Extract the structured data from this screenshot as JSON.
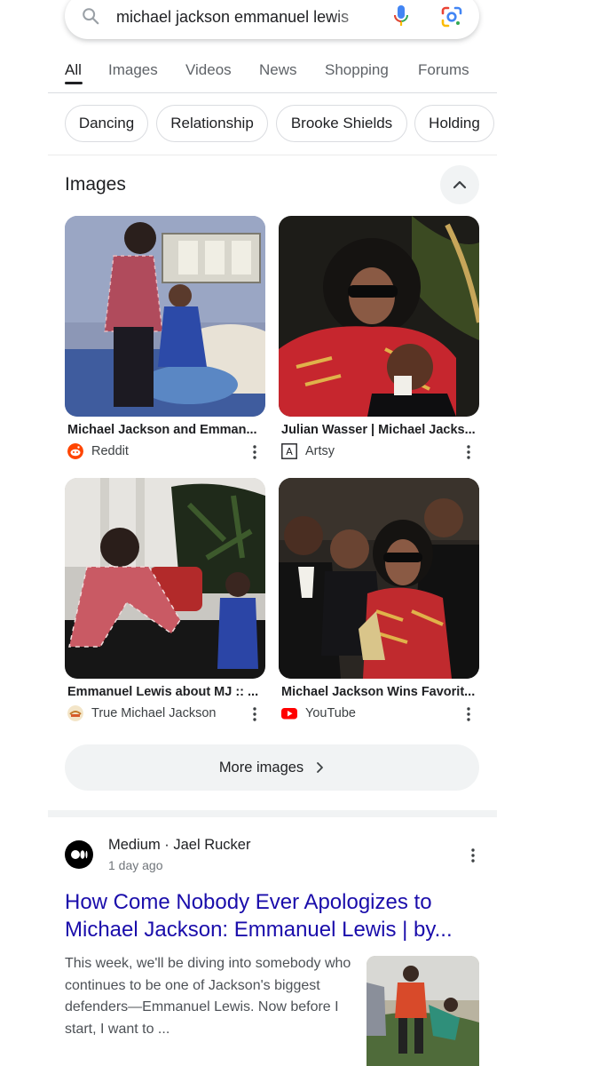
{
  "search": {
    "query": "michael jackson emmanuel lewis"
  },
  "tabs": [
    "All",
    "Images",
    "Videos",
    "News",
    "Shopping",
    "Forums"
  ],
  "active_tab": "All",
  "chips": [
    "Dancing",
    "Relationship",
    "Brooke Shields",
    "Holding"
  ],
  "images_section": {
    "title": "Images",
    "items": [
      {
        "title": "Michael Jackson and Emman...",
        "source": "Reddit"
      },
      {
        "title": "Julian Wasser | Michael Jacks...",
        "source": "Artsy"
      },
      {
        "title": "Emmanuel Lewis about MJ :: ...",
        "source": "True Michael Jackson"
      },
      {
        "title": "Michael Jackson Wins Favorit...",
        "source": "YouTube"
      }
    ],
    "more_label": "More images"
  },
  "result": {
    "site": "Medium · Jael Rucker",
    "time": "1 day ago",
    "title": "How Come Nobody Ever Apologizes to Michael Jackson: Emmanuel Lewis | by...",
    "snippet": "This week, we'll be diving into somebody who continues to be one of Jackson's biggest defenders—Emmanuel Lewis. Now before I start, I want to ..."
  },
  "colors": {
    "link": "#1a0dab",
    "reddit": "#ff4500",
    "youtube": "#ff0000",
    "chip_border": "#dadce0"
  }
}
